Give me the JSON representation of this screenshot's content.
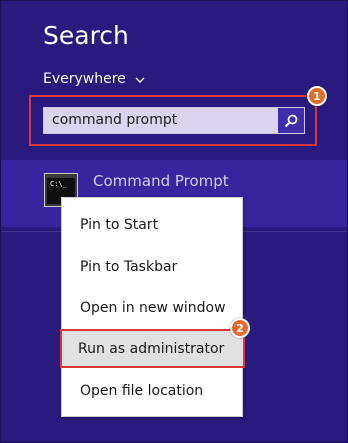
{
  "search_pane": {
    "title": "Search",
    "scope_label": "Everywhere",
    "search_input_value": "command prompt"
  },
  "annotations": {
    "step_1": "1",
    "step_2": "2"
  },
  "result": {
    "app_name": "Command Prompt",
    "icon_text": "C:\\_"
  },
  "context_menu": {
    "items": [
      {
        "label": "Pin to Start"
      },
      {
        "label": "Pin to Taskbar"
      },
      {
        "label": "Open in new window"
      },
      {
        "label": "Run as administrator"
      },
      {
        "label": "Open file location"
      }
    ]
  },
  "icons": {
    "search": "magnifier-icon",
    "scope": "chevron-down-icon",
    "app": "command-prompt-icon"
  },
  "colors": {
    "background": "#2a1a7d",
    "highlight_row": "#3924a0",
    "search_button": "#3f2ca8",
    "annotation_border": "#d9383a",
    "badge": "#e46b2d"
  }
}
